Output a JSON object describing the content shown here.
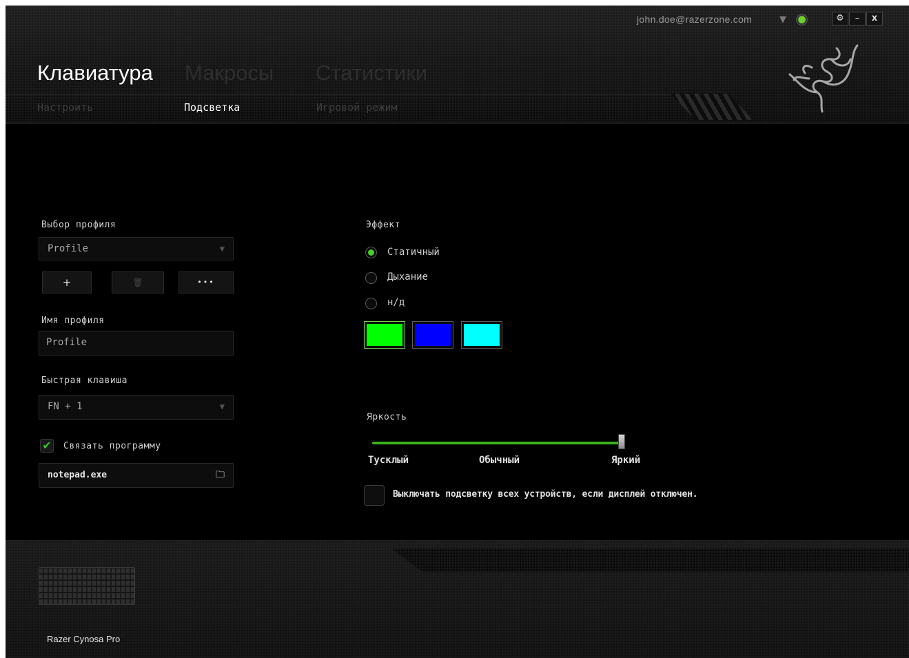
{
  "window": {
    "account_email": "john.doe@razerzone.com",
    "account_dropdown_icon": "▼",
    "settings_icon": "⚙",
    "minimize_icon": "–",
    "close_icon": "x"
  },
  "tabs": [
    {
      "label": "Клавиатура",
      "active": true
    },
    {
      "label": "Макросы",
      "active": false
    },
    {
      "label": "Статистики",
      "active": false
    }
  ],
  "subtabs": [
    {
      "label": "Настроить",
      "active": false
    },
    {
      "label": "Подсветка",
      "active": true
    },
    {
      "label": "Игровой режим",
      "active": false
    }
  ],
  "profile": {
    "select_label": "Выбор профиля",
    "select_value": "Profile",
    "add_icon": "+",
    "delete_icon": "🗑",
    "more_icon": "•••",
    "name_label": "Имя профиля",
    "name_value": "Profile",
    "hotkey_label": "Быстрая клавиша",
    "hotkey_value": "FN + 1",
    "link_program_label": "Связать программу",
    "link_program_checked": true,
    "program_value": "notepad.exe"
  },
  "effect": {
    "label": "Эффект",
    "options": [
      {
        "label": "Статичный",
        "selected": true
      },
      {
        "label": "Дыхание",
        "selected": false
      },
      {
        "label": "н/д",
        "selected": false
      }
    ],
    "colors": [
      "#00ff00",
      "#0000ff",
      "#00ffff"
    ]
  },
  "brightness": {
    "label": "Яркость",
    "min_label": "Тусклый",
    "mid_label": "Обычный",
    "max_label": "Яркий",
    "value": 1.0
  },
  "display_off": {
    "label": "Выключать подсветку всех устройств, если дисплей отключен.",
    "checked": false
  },
  "device": {
    "name": "Razer Cynosa Pro"
  },
  "accent_color": "#44d024"
}
